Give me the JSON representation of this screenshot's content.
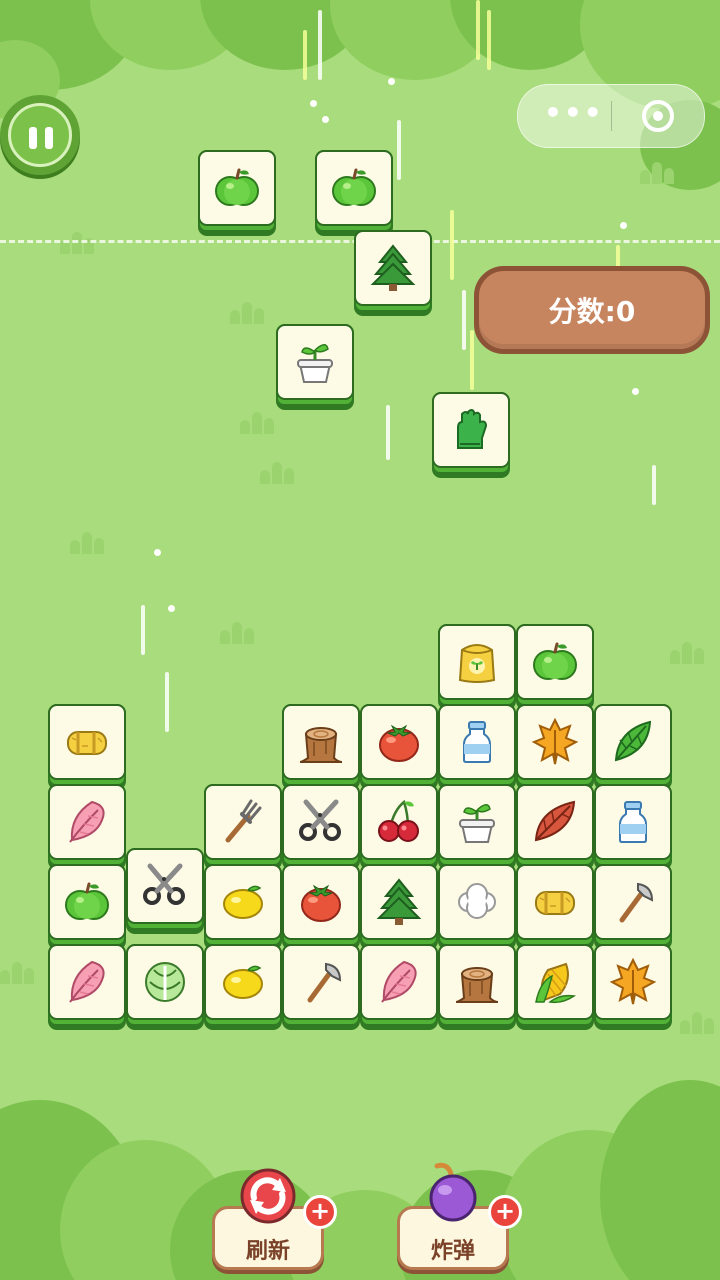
{
  "hud": {
    "score_label": "分数:0",
    "capsule_more_icon": "more-dots-icon",
    "capsule_close_icon": "target-close-icon",
    "pause_icon": "pause-icon"
  },
  "tools": {
    "refresh_label": "刷新",
    "bomb_label": "炸弹",
    "plus_symbol": "+"
  },
  "tiles": [
    {
      "item": "green-apple"
    },
    {
      "item": "green-apple"
    },
    {
      "item": "pine-tree"
    },
    {
      "item": "sprout-pot"
    },
    {
      "item": "green-glove"
    },
    {
      "item": "seed-bag"
    },
    {
      "item": "green-apple"
    },
    {
      "item": "hay-bale"
    },
    {
      "item": "tree-stump"
    },
    {
      "item": "tomato"
    },
    {
      "item": "milk-bottle"
    },
    {
      "item": "orange-leaf"
    },
    {
      "item": "green-leaf"
    },
    {
      "item": "pink-feather"
    },
    {
      "item": "pitchfork"
    },
    {
      "item": "scissors"
    },
    {
      "item": "cherries"
    },
    {
      "item": "sprout-pot"
    },
    {
      "item": "red-leaf"
    },
    {
      "item": "milk-bottle"
    },
    {
      "item": "green-apple"
    },
    {
      "item": "scissors"
    },
    {
      "item": "lemon"
    },
    {
      "item": "tomato"
    },
    {
      "item": "pine-tree"
    },
    {
      "item": "cotton"
    },
    {
      "item": "hay-bale"
    },
    {
      "item": "axe"
    },
    {
      "item": "pink-feather"
    },
    {
      "item": "cabbage"
    },
    {
      "item": "lemon"
    },
    {
      "item": "axe"
    },
    {
      "item": "pink-feather"
    },
    {
      "item": "tree-stump"
    },
    {
      "item": "corn"
    },
    {
      "item": "orange-leaf"
    }
  ],
  "colors": {
    "background": "#a9dc7c",
    "tile_face": "#fdfbe6",
    "tile_edge": "#2d6b21",
    "score_bg": "#c6845f"
  }
}
